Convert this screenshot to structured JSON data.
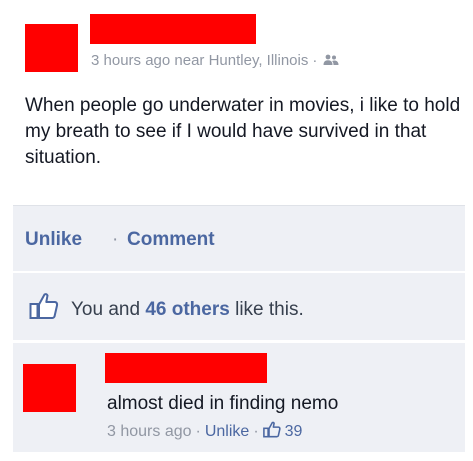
{
  "post": {
    "meta_time": "3 hours ago near Huntley, Illinois",
    "meta_dot": "·",
    "audience_icon": "people-icon",
    "text": "When people go underwater in movies, i like to hold my breath to see if I would have survived in that situation."
  },
  "actions": {
    "unlike_label": "Unlike",
    "dot": "·",
    "comment_label": "Comment"
  },
  "likes": {
    "icon": "thumbs-up-icon",
    "you_and": "You and ",
    "others": "46 others",
    "like_this": " like this."
  },
  "comment": {
    "text": "almost died in finding nemo",
    "time": "3 hours ago",
    "sep": "·",
    "unlike_label": "Unlike",
    "sep2": "·",
    "like_count": "39"
  },
  "colors": {
    "redaction": "#ff0000",
    "link": "#4b67a1",
    "panel": "#eef0f5",
    "meta": "#9197a3"
  }
}
